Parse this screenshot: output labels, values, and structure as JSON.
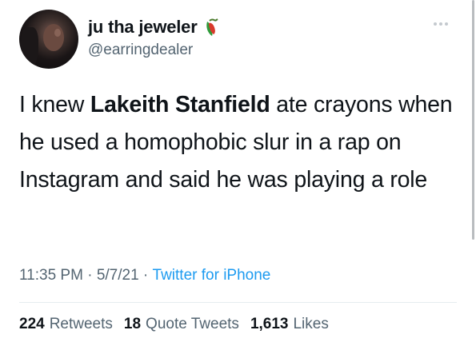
{
  "tweet": {
    "display_name": "ju tha jeweler",
    "handle": "@earringdealer",
    "body_prefix": "I knew ",
    "body_bold": "Lakeith Stanfield",
    "body_suffix": " ate crayons when he used a homophobic slur in a rap on Instagram and said he was playing a role",
    "time": "11:35 PM",
    "date": "5/7/21",
    "source": "Twitter for iPhone",
    "separator": " · "
  },
  "stats": {
    "retweets_count": "224",
    "retweets_label": "Retweets",
    "quotes_count": "18",
    "quotes_label": "Quote Tweets",
    "likes_count": "1,613",
    "likes_label": "Likes"
  },
  "icons": {
    "name_emoji": "pepper-emoji-icon",
    "more": "more-options-icon"
  },
  "colors": {
    "link": "#1d9bf0",
    "muted": "#536471",
    "text": "#0f1419"
  }
}
